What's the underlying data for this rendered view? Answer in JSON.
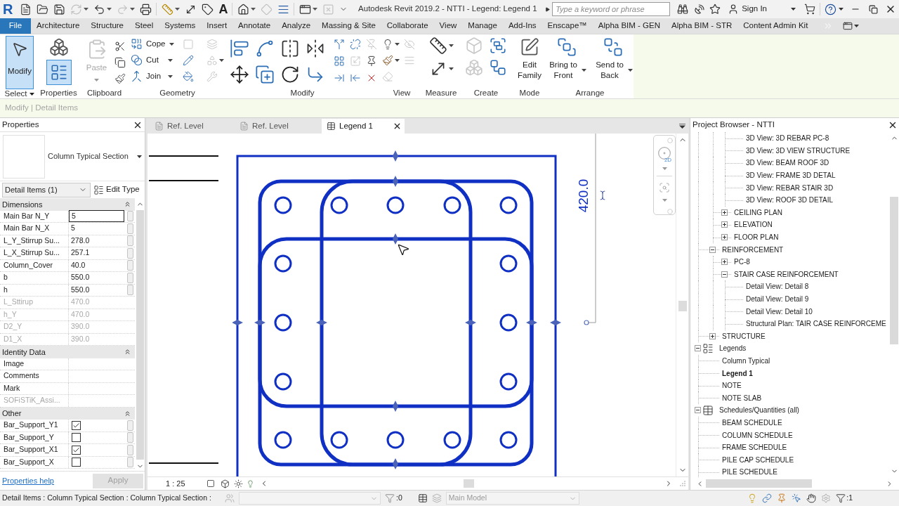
{
  "title_bar": {
    "logo": "R",
    "quick_access": [
      {
        "disabled": false,
        "has_menu": false
      },
      {
        "disabled": false,
        "has_menu": false
      },
      {
        "disabled": false,
        "has_menu": false
      },
      {
        "disabled": true,
        "has_menu": true
      },
      {
        "disabled": false,
        "has_menu": true
      },
      {
        "disabled": true,
        "has_menu": true
      },
      {
        "disabled": false,
        "has_menu": false
      },
      {
        "disabled": false,
        "has_menu": true
      },
      {
        "disabled": false,
        "has_menu": false
      },
      {
        "disabled": false,
        "has_menu": false
      },
      {
        "disabled": false,
        "has_menu": false,
        "glyph": "A"
      },
      {
        "disabled": false,
        "has_menu": true
      },
      {
        "disabled": true,
        "has_menu": false
      },
      {
        "disabled": false,
        "has_menu": false
      },
      {
        "disabled": false,
        "has_menu": true
      },
      {
        "disabled": true,
        "has_menu": false
      },
      {
        "disabled": false,
        "has_menu": false
      }
    ],
    "title": "Autodesk Revit 2019.2 - NTTI - Legend: Legend 1",
    "search": {
      "placeholder": "Type a keyword or phrase"
    },
    "sign_in": "Sign In"
  },
  "ribbon_tabs": [
    {
      "label": "File",
      "kind": "application",
      "selected": false
    },
    {
      "label": "Architecture",
      "kind": "tab",
      "selected": false
    },
    {
      "label": "Structure",
      "kind": "tab",
      "selected": false
    },
    {
      "label": "Steel",
      "kind": "tab",
      "selected": false
    },
    {
      "label": "Systems",
      "kind": "tab",
      "selected": false
    },
    {
      "label": "Insert",
      "kind": "tab",
      "selected": false
    },
    {
      "label": "Annotate",
      "kind": "tab",
      "selected": false
    },
    {
      "label": "Analyze",
      "kind": "tab",
      "selected": false
    },
    {
      "label": "Massing & Site",
      "kind": "tab",
      "selected": false
    },
    {
      "label": "Collaborate",
      "kind": "tab",
      "selected": false
    },
    {
      "label": "View",
      "kind": "tab",
      "selected": false
    },
    {
      "label": "Manage",
      "kind": "tab",
      "selected": false
    },
    {
      "label": "Add-Ins",
      "kind": "tab",
      "selected": false
    },
    {
      "label": "Enscape™",
      "kind": "tab",
      "selected": false
    },
    {
      "label": "Alpha BIM - GEN",
      "kind": "tab",
      "selected": false
    },
    {
      "label": "Alpha BIM - STR",
      "kind": "tab",
      "selected": false
    },
    {
      "label": "Content Admin Kit",
      "kind": "tab",
      "selected": false
    }
  ],
  "ribbon": {
    "panels": [
      {
        "label": "Select",
        "has_menu": true,
        "tools": [
          {
            "label": "Modify",
            "active": true,
            "disabled": false
          }
        ]
      },
      {
        "label": "Properties",
        "tools": [
          {
            "active": false,
            "disabled": false
          },
          {
            "active": true,
            "disabled": false
          }
        ]
      },
      {
        "label": "Clipboard",
        "tools": [
          {
            "label": "Paste",
            "disabled": true,
            "has_menu": true
          },
          {
            "disabled": false
          },
          {
            "disabled": false
          },
          {
            "disabled": false
          }
        ]
      },
      {
        "label": "Geometry",
        "tools": [
          {
            "label": "Cope",
            "disabled": false,
            "has_menu": true
          },
          {
            "label": "Cut",
            "disabled": false,
            "has_menu": true
          },
          {
            "label": "Join",
            "disabled": false,
            "has_menu": true
          },
          {
            "disabled": true
          },
          {
            "disabled": true
          },
          {
            "disabled": false
          },
          {
            "disabled": true,
            "has_menu": true
          },
          {
            "disabled": false
          },
          {
            "disabled": true
          }
        ]
      },
      {
        "label": "Modify",
        "tools": [
          {
            "disabled": false
          },
          {
            "disabled": false
          },
          {
            "disabled": false
          },
          {
            "disabled": false
          },
          {
            "disabled": false
          },
          {
            "disabled": false
          },
          {
            "disabled": false
          },
          {
            "disabled": false
          },
          {
            "disabled": false
          },
          {
            "disabled": false
          },
          {
            "disabled": true
          },
          {
            "disabled": false
          },
          {
            "disabled": true
          },
          {
            "disabled": false
          },
          {
            "disabled": false
          },
          {
            "disabled": false
          },
          {
            "disabled": false
          }
        ]
      },
      {
        "label": "View",
        "tools": [
          {
            "disabled": false,
            "has_menu": true
          },
          {
            "disabled": true
          },
          {
            "disabled": false,
            "has_menu": true
          },
          {
            "disabled": true
          },
          {
            "disabled": true
          }
        ]
      },
      {
        "label": "Measure",
        "tools": [
          {
            "disabled": false,
            "has_menu": true
          },
          {
            "disabled": false,
            "has_menu": true
          }
        ]
      },
      {
        "label": "Create",
        "tools": [
          {
            "disabled": true
          },
          {
            "disabled": false
          },
          {
            "disabled": true
          },
          {
            "disabled": false
          }
        ]
      },
      {
        "label": "Mode",
        "tools": [
          {
            "label": "Edit Family",
            "disabled": false
          }
        ]
      },
      {
        "label": "Arrange",
        "tools": [
          {
            "label": "Bring to Front",
            "disabled": false,
            "has_menu": true
          },
          {
            "label": "Send to Back",
            "disabled": false,
            "has_menu": true
          }
        ]
      }
    ]
  },
  "options_bar": {
    "context": "Modify | Detail Items"
  },
  "properties": {
    "title": "Properties",
    "type_name": "Column Typical Section",
    "filter": "Detail Items (1)",
    "edit_type": "Edit Type",
    "groups": [
      {
        "name": "Dimensions",
        "expanded": true,
        "rows": [
          {
            "name": "Main Bar N_Y",
            "value": "5",
            "kind": "text",
            "disabled": false,
            "editing": true,
            "associate": true
          },
          {
            "name": "Main Bar N_X",
            "value": "5",
            "kind": "text",
            "disabled": false,
            "editing": false,
            "associate": true
          },
          {
            "name": "L_Y_Stirrup Su...",
            "value": "278.0",
            "kind": "text",
            "disabled": false,
            "editing": false,
            "associate": true
          },
          {
            "name": "L_X_Stirrup Su...",
            "value": "257.1",
            "kind": "text",
            "disabled": false,
            "editing": false,
            "associate": true
          },
          {
            "name": "Column_Cover",
            "value": "40.0",
            "kind": "text",
            "disabled": false,
            "editing": false,
            "associate": true
          },
          {
            "name": "b",
            "value": "550.0",
            "kind": "text",
            "disabled": false,
            "editing": false,
            "associate": true
          },
          {
            "name": "h",
            "value": "550.0",
            "kind": "text",
            "disabled": false,
            "editing": false,
            "associate": true
          },
          {
            "name": "L_Sttirup",
            "value": "470.0",
            "kind": "text",
            "disabled": true,
            "editing": false,
            "associate": false
          },
          {
            "name": "h_Y",
            "value": "470.0",
            "kind": "text",
            "disabled": true,
            "editing": false,
            "associate": false
          },
          {
            "name": "D2_Y",
            "value": "390.0",
            "kind": "text",
            "disabled": true,
            "editing": false,
            "associate": false
          },
          {
            "name": "D1_X",
            "value": "390.0",
            "kind": "text",
            "disabled": true,
            "editing": false,
            "associate": false
          }
        ]
      },
      {
        "name": "Identity Data",
        "expanded": true,
        "rows": [
          {
            "name": "Image",
            "kind": "text",
            "disabled": false,
            "editing": false,
            "associate": false
          },
          {
            "name": "Comments",
            "kind": "text",
            "disabled": false,
            "editing": false,
            "associate": false
          },
          {
            "name": "Mark",
            "kind": "text",
            "disabled": false,
            "editing": false,
            "associate": false
          },
          {
            "name": "SOFiSTiK_Assi...",
            "kind": "text",
            "disabled": true,
            "editing": false,
            "associate": false
          }
        ]
      },
      {
        "name": "Other",
        "expanded": true,
        "rows": [
          {
            "name": "Bar_Support_Y1",
            "kind": "checkbox",
            "checked": true,
            "disabled": false,
            "associate": true
          },
          {
            "name": "Bar_Support_Y",
            "kind": "checkbox",
            "checked": false,
            "disabled": false,
            "associate": true
          },
          {
            "name": "Bar_Support_X1",
            "kind": "checkbox",
            "checked": true,
            "disabled": false,
            "associate": true
          },
          {
            "name": "Bar_Support_X",
            "kind": "checkbox",
            "checked": false,
            "disabled": false,
            "associate": true
          }
        ]
      }
    ],
    "help_link": "Properties help",
    "apply": {
      "label": "Apply",
      "disabled": true
    }
  },
  "view_tabs": [
    {
      "label": "Ref. Level",
      "kind": "plan",
      "selected": false
    },
    {
      "label": "Ref. Level",
      "kind": "plan",
      "selected": false
    },
    {
      "label": "Legend 1",
      "kind": "legend",
      "selected": true
    }
  ],
  "canvas": {
    "dimension": "420.0",
    "wheel_label": "2D",
    "scale": "1 : 25"
  },
  "project_browser": {
    "title": "Project Browser - NTTI",
    "tree": [
      {
        "children": [
          {
            "children": [
              {
                "children": [
                  {
                    "label": "3D View: 3D REBAR PC-8"
                  },
                  {
                    "label": "3D View: 3D VIEW STRUCTURE"
                  },
                  {
                    "label": "3D View: BEAM ROOF 3D"
                  },
                  {
                    "label": "3D View: FRAME 3D  DETAL"
                  },
                  {
                    "label": "3D View: REBAR STAIR 3D"
                  },
                  {
                    "label": "3D View: ROOF 3D DETAIL"
                  }
                ]
              },
              {
                "label": "CEILING PLAN",
                "expanded": false
              },
              {
                "label": "ELEVATION",
                "expanded": false
              },
              {
                "label": "FLOOR PLAN",
                "expanded": false
              }
            ]
          },
          {
            "label": "REINFORCEMENT",
            "expanded": true,
            "children": [
              {
                "label": "PC-8",
                "expanded": false
              },
              {
                "label": "STAIR CASE REINFORCEMENT",
                "expanded": true,
                "children": [
                  {
                    "label": "Detail View: Detail 8"
                  },
                  {
                    "label": "Detail View: Detail 9"
                  },
                  {
                    "label": "Detail View: Detail 10"
                  },
                  {
                    "label": "Structural Plan: TAIR CASE REINFORCEME"
                  }
                ]
              }
            ]
          },
          {
            "label": "STRUCTURE",
            "expanded": false
          }
        ]
      },
      {
        "label": "Legends",
        "kind": "legend",
        "expanded": true,
        "children": [
          {
            "label": "Column Typical",
            "active": false
          },
          {
            "label": "Legend 1",
            "active": true
          },
          {
            "label": "NOTE",
            "active": false
          },
          {
            "label": "NOTE SLAB",
            "active": false
          }
        ]
      },
      {
        "label": "Schedules/Quantities (all)",
        "kind": "schedule",
        "expanded": true,
        "children": [
          {
            "label": "BEAM SCHEDULE"
          },
          {
            "label": "COLUMN SCHEDULE"
          },
          {
            "label": "FRAME SCHEDULE"
          },
          {
            "label": "PILE CAP SCHEDULE"
          },
          {
            "label": "PILE SCHEDULE"
          }
        ]
      }
    ]
  },
  "status_bar": {
    "selection": "Detail Items : Column Typical Section : Column Typical Section :",
    "workset_field": {
      "disabled": true
    },
    "left_counter": ":0",
    "design_option": {
      "value": "Main Model",
      "disabled": true
    },
    "filter_counter": ":1"
  }
}
